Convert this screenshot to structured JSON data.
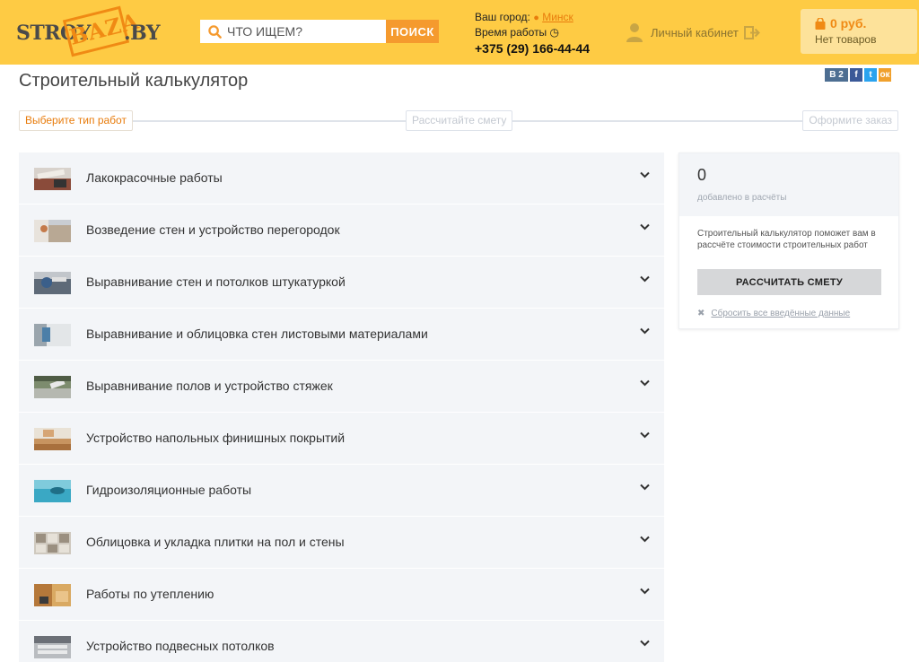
{
  "header": {
    "logo": {
      "part1": "STROY",
      "part2": "BAZA",
      "part3": ".BY"
    },
    "search": {
      "placeholder": "ЧТО ИЩЕМ?",
      "button_label": "ПОИСК"
    },
    "city": {
      "label": "Ваш город:",
      "name": "Минск",
      "hours_label": "Время работы",
      "phone": "+375 (29) 166-44-44"
    },
    "account_label": "Личный кабинет",
    "cart": {
      "price": "0 руб.",
      "items": "Нет товаров"
    },
    "colors": {
      "background": "#fecb44",
      "accent": "#f59a2e"
    }
  },
  "page": {
    "title": "Строительный калькулятор",
    "social": {
      "vk_label": "В",
      "vk_count": "2",
      "fb_label": "f",
      "tw_label": "t",
      "ok_label": "ок"
    }
  },
  "steps": [
    {
      "label": "Выберите тип работ",
      "active": true
    },
    {
      "label": "Рассчитайте смету",
      "active": false
    },
    {
      "label": "Оформите заказ",
      "active": false
    }
  ],
  "categories": [
    {
      "label": "Лакокрасочные работы",
      "icon": "paint-icon"
    },
    {
      "label": "Возведение стен и устройство перегородок",
      "icon": "wall-icon"
    },
    {
      "label": "Выравнивание стен и потолков штукатуркой",
      "icon": "plaster-icon"
    },
    {
      "label": "Выравнивание и облицовка стен листовыми материалами",
      "icon": "drywall-icon"
    },
    {
      "label": "Выравнивание полов и устройство стяжек",
      "icon": "screed-icon"
    },
    {
      "label": "Устройство напольных финишных покрытий",
      "icon": "floor-icon"
    },
    {
      "label": "Гидроизоляционные работы",
      "icon": "waterproof-icon"
    },
    {
      "label": "Облицовка и укладка плитки на пол и стены",
      "icon": "tile-icon"
    },
    {
      "label": "Работы по утеплению",
      "icon": "insulation-icon"
    },
    {
      "label": "Устройство подвесных потолков",
      "icon": "ceiling-icon"
    }
  ],
  "sidebar": {
    "count": "0",
    "count_label": "добавлено в расчёты",
    "description": "Строительный калькулятор поможет вам в рассчёте стоимости строительных работ",
    "calc_button": "РАССЧИТАТЬ СМЕТУ",
    "reset_label": "Сбросить все введённые данные"
  }
}
